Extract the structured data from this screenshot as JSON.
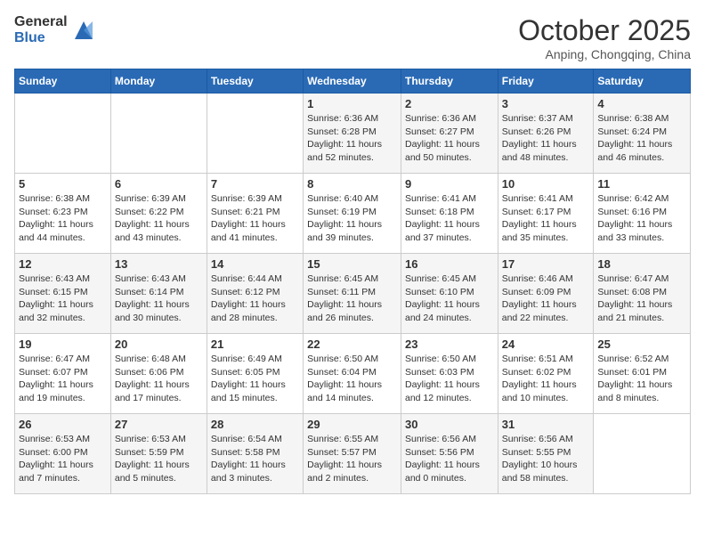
{
  "logo": {
    "general": "General",
    "blue": "Blue"
  },
  "title": "October 2025",
  "location": "Anping, Chongqing, China",
  "days_of_week": [
    "Sunday",
    "Monday",
    "Tuesday",
    "Wednesday",
    "Thursday",
    "Friday",
    "Saturday"
  ],
  "weeks": [
    [
      {
        "day": "",
        "info": ""
      },
      {
        "day": "",
        "info": ""
      },
      {
        "day": "",
        "info": ""
      },
      {
        "day": "1",
        "info": "Sunrise: 6:36 AM\nSunset: 6:28 PM\nDaylight: 11 hours and 52 minutes."
      },
      {
        "day": "2",
        "info": "Sunrise: 6:36 AM\nSunset: 6:27 PM\nDaylight: 11 hours and 50 minutes."
      },
      {
        "day": "3",
        "info": "Sunrise: 6:37 AM\nSunset: 6:26 PM\nDaylight: 11 hours and 48 minutes."
      },
      {
        "day": "4",
        "info": "Sunrise: 6:38 AM\nSunset: 6:24 PM\nDaylight: 11 hours and 46 minutes."
      }
    ],
    [
      {
        "day": "5",
        "info": "Sunrise: 6:38 AM\nSunset: 6:23 PM\nDaylight: 11 hours and 44 minutes."
      },
      {
        "day": "6",
        "info": "Sunrise: 6:39 AM\nSunset: 6:22 PM\nDaylight: 11 hours and 43 minutes."
      },
      {
        "day": "7",
        "info": "Sunrise: 6:39 AM\nSunset: 6:21 PM\nDaylight: 11 hours and 41 minutes."
      },
      {
        "day": "8",
        "info": "Sunrise: 6:40 AM\nSunset: 6:19 PM\nDaylight: 11 hours and 39 minutes."
      },
      {
        "day": "9",
        "info": "Sunrise: 6:41 AM\nSunset: 6:18 PM\nDaylight: 11 hours and 37 minutes."
      },
      {
        "day": "10",
        "info": "Sunrise: 6:41 AM\nSunset: 6:17 PM\nDaylight: 11 hours and 35 minutes."
      },
      {
        "day": "11",
        "info": "Sunrise: 6:42 AM\nSunset: 6:16 PM\nDaylight: 11 hours and 33 minutes."
      }
    ],
    [
      {
        "day": "12",
        "info": "Sunrise: 6:43 AM\nSunset: 6:15 PM\nDaylight: 11 hours and 32 minutes."
      },
      {
        "day": "13",
        "info": "Sunrise: 6:43 AM\nSunset: 6:14 PM\nDaylight: 11 hours and 30 minutes."
      },
      {
        "day": "14",
        "info": "Sunrise: 6:44 AM\nSunset: 6:12 PM\nDaylight: 11 hours and 28 minutes."
      },
      {
        "day": "15",
        "info": "Sunrise: 6:45 AM\nSunset: 6:11 PM\nDaylight: 11 hours and 26 minutes."
      },
      {
        "day": "16",
        "info": "Sunrise: 6:45 AM\nSunset: 6:10 PM\nDaylight: 11 hours and 24 minutes."
      },
      {
        "day": "17",
        "info": "Sunrise: 6:46 AM\nSunset: 6:09 PM\nDaylight: 11 hours and 22 minutes."
      },
      {
        "day": "18",
        "info": "Sunrise: 6:47 AM\nSunset: 6:08 PM\nDaylight: 11 hours and 21 minutes."
      }
    ],
    [
      {
        "day": "19",
        "info": "Sunrise: 6:47 AM\nSunset: 6:07 PM\nDaylight: 11 hours and 19 minutes."
      },
      {
        "day": "20",
        "info": "Sunrise: 6:48 AM\nSunset: 6:06 PM\nDaylight: 11 hours and 17 minutes."
      },
      {
        "day": "21",
        "info": "Sunrise: 6:49 AM\nSunset: 6:05 PM\nDaylight: 11 hours and 15 minutes."
      },
      {
        "day": "22",
        "info": "Sunrise: 6:50 AM\nSunset: 6:04 PM\nDaylight: 11 hours and 14 minutes."
      },
      {
        "day": "23",
        "info": "Sunrise: 6:50 AM\nSunset: 6:03 PM\nDaylight: 11 hours and 12 minutes."
      },
      {
        "day": "24",
        "info": "Sunrise: 6:51 AM\nSunset: 6:02 PM\nDaylight: 11 hours and 10 minutes."
      },
      {
        "day": "25",
        "info": "Sunrise: 6:52 AM\nSunset: 6:01 PM\nDaylight: 11 hours and 8 minutes."
      }
    ],
    [
      {
        "day": "26",
        "info": "Sunrise: 6:53 AM\nSunset: 6:00 PM\nDaylight: 11 hours and 7 minutes."
      },
      {
        "day": "27",
        "info": "Sunrise: 6:53 AM\nSunset: 5:59 PM\nDaylight: 11 hours and 5 minutes."
      },
      {
        "day": "28",
        "info": "Sunrise: 6:54 AM\nSunset: 5:58 PM\nDaylight: 11 hours and 3 minutes."
      },
      {
        "day": "29",
        "info": "Sunrise: 6:55 AM\nSunset: 5:57 PM\nDaylight: 11 hours and 2 minutes."
      },
      {
        "day": "30",
        "info": "Sunrise: 6:56 AM\nSunset: 5:56 PM\nDaylight: 11 hours and 0 minutes."
      },
      {
        "day": "31",
        "info": "Sunrise: 6:56 AM\nSunset: 5:55 PM\nDaylight: 10 hours and 58 minutes."
      },
      {
        "day": "",
        "info": ""
      }
    ]
  ]
}
